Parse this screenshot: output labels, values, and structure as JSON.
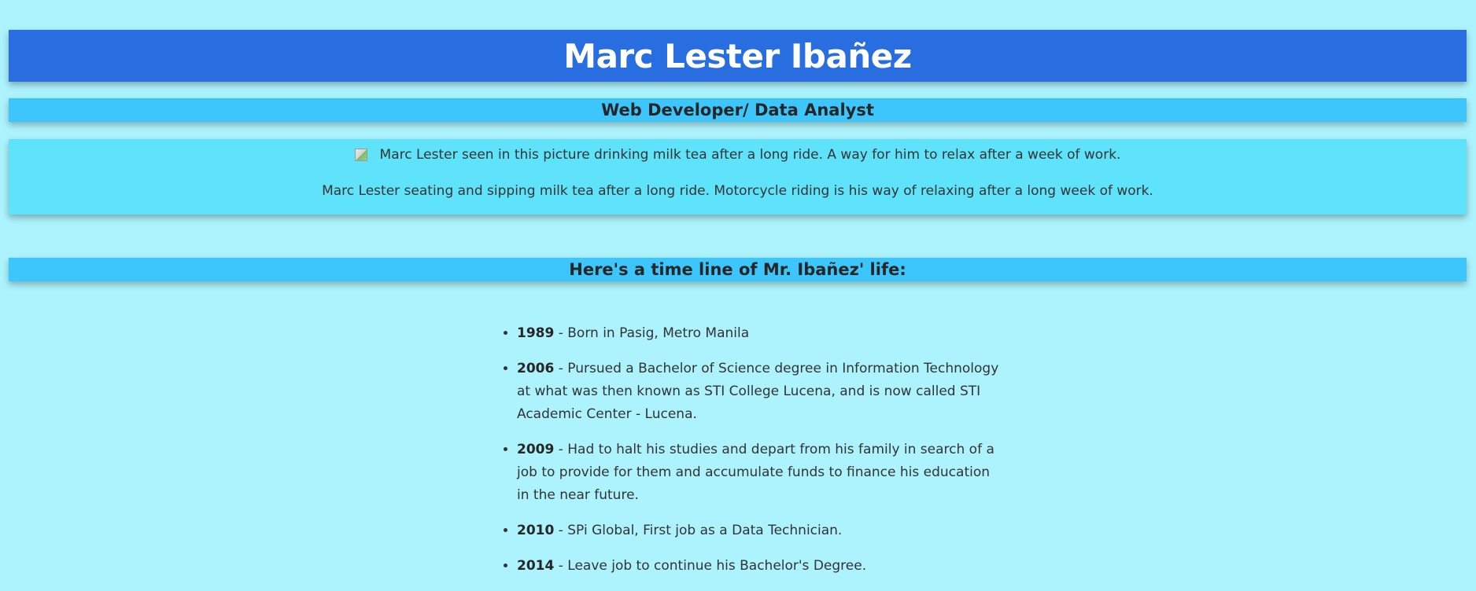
{
  "header": {
    "name": "Marc Lester Ibañez",
    "role": "Web Developer/ Data Analyst"
  },
  "photo": {
    "icon": "broken-image-icon",
    "alt": "Marc Lester seen in this picture drinking milk tea after a long ride. A way for him to relax after a week of work.",
    "caption": "Marc Lester seating and sipping milk tea after a long ride. Motorcycle riding is his way of relaxing after a long week of work."
  },
  "timeline": {
    "heading": "Here's a time line of Mr. Ibañez' life:",
    "items": [
      {
        "year": "1989",
        "text": " - Born in Pasig, Metro Manila"
      },
      {
        "year": "2006",
        "text": " - Pursued a Bachelor of Science degree in Information Technology at what was then known as STI College Lucena, and is now called STI Academic Center - Lucena."
      },
      {
        "year": "2009",
        "text": " - Had to halt his studies and depart from his family in search of a job to provide for them and accumulate funds to finance his education in the near future."
      },
      {
        "year": "2010",
        "text": " - SPi Global, First job as a Data Technician."
      },
      {
        "year": "2014",
        "text": " - Leave job to continue his Bachelor's Degree."
      }
    ]
  },
  "colors": {
    "page_background": "#ADF3FD",
    "title_bar": "#296EE0",
    "sub_bar": "#3DC6FB",
    "photo_panel": "#5EE3FA"
  }
}
